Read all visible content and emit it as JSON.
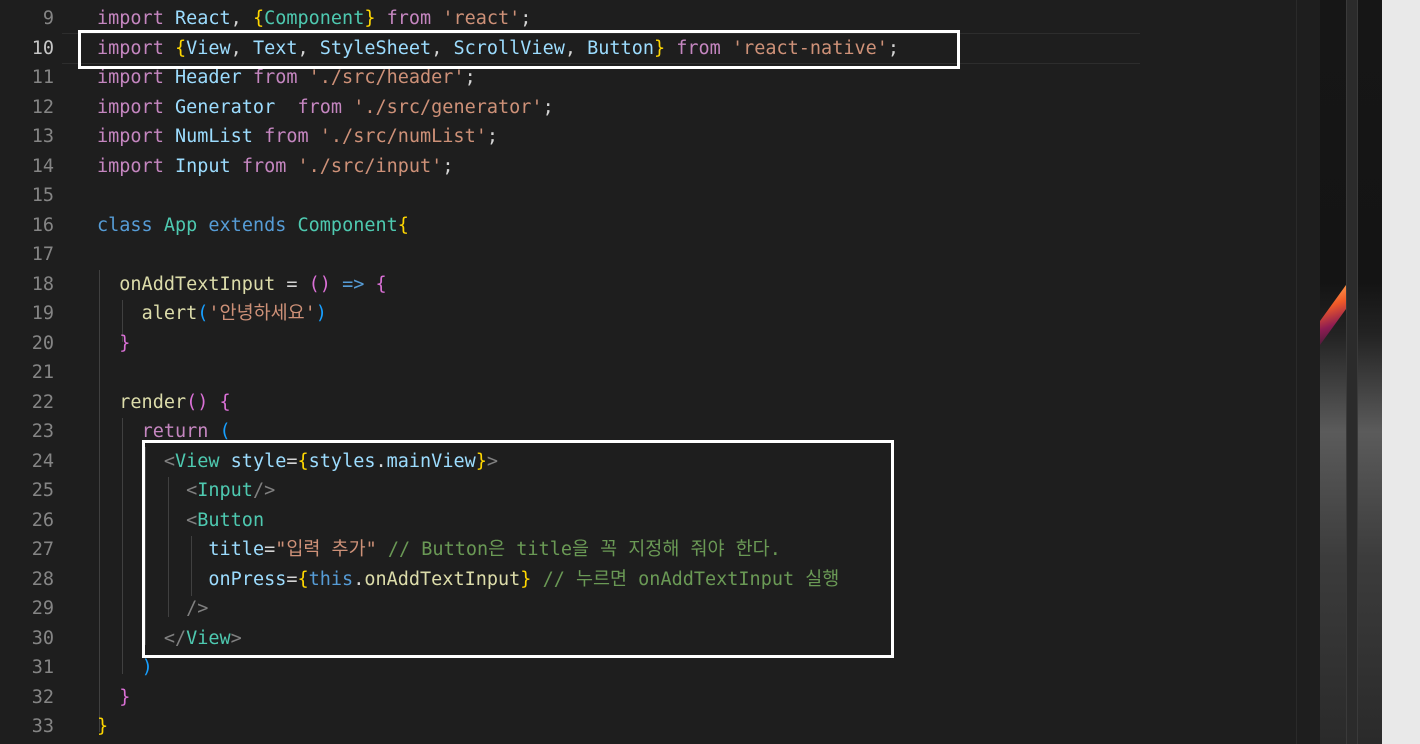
{
  "editor": {
    "lines": [
      {
        "num": "9",
        "tokens": [
          [
            "k",
            "import"
          ],
          [
            "p",
            " "
          ],
          [
            "v",
            "React"
          ],
          [
            "p",
            ", "
          ],
          [
            "b1",
            "{"
          ],
          [
            "t",
            "Component"
          ],
          [
            "b1",
            "}"
          ],
          [
            "p",
            " "
          ],
          [
            "k",
            "from"
          ],
          [
            "p",
            " "
          ],
          [
            "s",
            "'react'"
          ],
          [
            "p",
            ";"
          ]
        ]
      },
      {
        "num": "10",
        "tokens": [
          [
            "k",
            "import"
          ],
          [
            "p",
            " "
          ],
          [
            "b1",
            "{"
          ],
          [
            "v",
            "View"
          ],
          [
            "p",
            ", "
          ],
          [
            "v",
            "Text"
          ],
          [
            "p",
            ", "
          ],
          [
            "v",
            "StyleSheet"
          ],
          [
            "p",
            ", "
          ],
          [
            "v",
            "ScrollView"
          ],
          [
            "p",
            ", "
          ],
          [
            "v",
            "Button"
          ],
          [
            "b1",
            "}"
          ],
          [
            "p",
            " "
          ],
          [
            "k",
            "from"
          ],
          [
            "p",
            " "
          ],
          [
            "s",
            "'react-native'"
          ],
          [
            "p",
            ";"
          ]
        ]
      },
      {
        "num": "11",
        "tokens": [
          [
            "k",
            "import"
          ],
          [
            "p",
            " "
          ],
          [
            "v",
            "Header"
          ],
          [
            "p",
            " "
          ],
          [
            "k",
            "from"
          ],
          [
            "p",
            " "
          ],
          [
            "s",
            "'./src/header'"
          ],
          [
            "p",
            ";"
          ]
        ]
      },
      {
        "num": "12",
        "tokens": [
          [
            "k",
            "import"
          ],
          [
            "p",
            " "
          ],
          [
            "v",
            "Generator"
          ],
          [
            "p",
            "  "
          ],
          [
            "k",
            "from"
          ],
          [
            "p",
            " "
          ],
          [
            "s",
            "'./src/generator'"
          ],
          [
            "p",
            ";"
          ]
        ]
      },
      {
        "num": "13",
        "tokens": [
          [
            "k",
            "import"
          ],
          [
            "p",
            " "
          ],
          [
            "v",
            "NumList"
          ],
          [
            "p",
            " "
          ],
          [
            "k",
            "from"
          ],
          [
            "p",
            " "
          ],
          [
            "s",
            "'./src/numList'"
          ],
          [
            "p",
            ";"
          ]
        ]
      },
      {
        "num": "14",
        "tokens": [
          [
            "k",
            "import"
          ],
          [
            "p",
            " "
          ],
          [
            "v",
            "Input"
          ],
          [
            "p",
            " "
          ],
          [
            "k",
            "from"
          ],
          [
            "p",
            " "
          ],
          [
            "s",
            "'./src/input'"
          ],
          [
            "p",
            ";"
          ]
        ]
      },
      {
        "num": "15",
        "tokens": []
      },
      {
        "num": "16",
        "tokens": [
          [
            "kb",
            "class"
          ],
          [
            "p",
            " "
          ],
          [
            "t",
            "App"
          ],
          [
            "p",
            " "
          ],
          [
            "kb",
            "extends"
          ],
          [
            "p",
            " "
          ],
          [
            "t",
            "Component"
          ],
          [
            "b1",
            "{"
          ]
        ]
      },
      {
        "num": "17",
        "tokens": []
      },
      {
        "num": "18",
        "tokens": [
          [
            "p",
            "  "
          ],
          [
            "f",
            "onAddTextInput"
          ],
          [
            "p",
            " = "
          ],
          [
            "b2",
            "()"
          ],
          [
            "p",
            " "
          ],
          [
            "kb",
            "=>"
          ],
          [
            "p",
            " "
          ],
          [
            "b2",
            "{"
          ]
        ]
      },
      {
        "num": "19",
        "tokens": [
          [
            "p",
            "    "
          ],
          [
            "f",
            "alert"
          ],
          [
            "b3",
            "("
          ],
          [
            "s",
            "'안녕하세요'"
          ],
          [
            "b3",
            ")"
          ]
        ]
      },
      {
        "num": "20",
        "tokens": [
          [
            "p",
            "  "
          ],
          [
            "b2",
            "}"
          ]
        ]
      },
      {
        "num": "21",
        "tokens": []
      },
      {
        "num": "22",
        "tokens": [
          [
            "p",
            "  "
          ],
          [
            "f",
            "render"
          ],
          [
            "b2",
            "()"
          ],
          [
            "p",
            " "
          ],
          [
            "b2",
            "{"
          ]
        ]
      },
      {
        "num": "23",
        "tokens": [
          [
            "p",
            "    "
          ],
          [
            "k",
            "return"
          ],
          [
            "p",
            " "
          ],
          [
            "b3",
            "("
          ]
        ]
      },
      {
        "num": "24",
        "tokens": [
          [
            "p",
            "      "
          ],
          [
            "g",
            "<"
          ],
          [
            "t",
            "View"
          ],
          [
            "p",
            " "
          ],
          [
            "v",
            "style"
          ],
          [
            "p",
            "="
          ],
          [
            "b1",
            "{"
          ],
          [
            "v",
            "styles"
          ],
          [
            "p",
            "."
          ],
          [
            "v",
            "mainView"
          ],
          [
            "b1",
            "}"
          ],
          [
            "g",
            ">"
          ]
        ]
      },
      {
        "num": "25",
        "tokens": [
          [
            "p",
            "        "
          ],
          [
            "g",
            "<"
          ],
          [
            "t",
            "Input"
          ],
          [
            "g",
            "/>"
          ]
        ]
      },
      {
        "num": "26",
        "tokens": [
          [
            "p",
            "        "
          ],
          [
            "g",
            "<"
          ],
          [
            "t",
            "Button"
          ]
        ]
      },
      {
        "num": "27",
        "tokens": [
          [
            "p",
            "          "
          ],
          [
            "v",
            "title"
          ],
          [
            "p",
            "="
          ],
          [
            "s",
            "\"입력 추가\""
          ],
          [
            "p",
            " "
          ],
          [
            "c",
            "// Button은 title을 꼭 지정해 줘야 한다."
          ]
        ]
      },
      {
        "num": "28",
        "tokens": [
          [
            "p",
            "          "
          ],
          [
            "v",
            "onPress"
          ],
          [
            "p",
            "="
          ],
          [
            "b1",
            "{"
          ],
          [
            "kb",
            "this"
          ],
          [
            "p",
            "."
          ],
          [
            "f",
            "onAddTextInput"
          ],
          [
            "b1",
            "}"
          ],
          [
            "p",
            " "
          ],
          [
            "c",
            "// 누르면 onAddTextInput 실행"
          ]
        ]
      },
      {
        "num": "29",
        "tokens": [
          [
            "p",
            "        "
          ],
          [
            "g",
            "/>"
          ]
        ]
      },
      {
        "num": "30",
        "tokens": [
          [
            "p",
            "      "
          ],
          [
            "g",
            "</"
          ],
          [
            "t",
            "View"
          ],
          [
            "g",
            ">"
          ]
        ]
      },
      {
        "num": "31",
        "tokens": [
          [
            "p",
            "    "
          ],
          [
            "b3",
            ")"
          ]
        ]
      },
      {
        "num": "32",
        "tokens": [
          [
            "p",
            "  "
          ],
          [
            "b2",
            "}"
          ]
        ]
      },
      {
        "num": "33",
        "tokens": [
          [
            "b1",
            "}"
          ]
        ]
      }
    ],
    "active_line": "10"
  },
  "colors": {
    "background": "#1e1e1e",
    "highlight_box": "#ffffff",
    "keyword": "#c586c0",
    "string": "#ce9178",
    "comment": "#6a9955"
  }
}
